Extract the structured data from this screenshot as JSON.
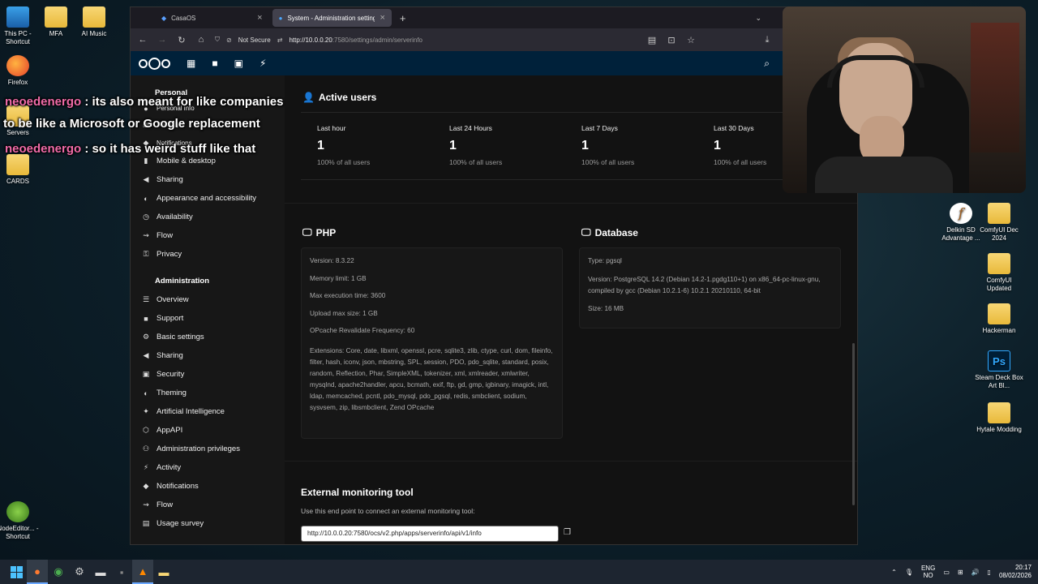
{
  "desktop": {
    "icons_left": [
      {
        "label": "This PC - Shortcut",
        "kind": "pc"
      },
      {
        "label": "MFA",
        "kind": "folder"
      },
      {
        "label": "AI Music",
        "kind": "folder"
      },
      {
        "label": "Firefox",
        "kind": "ff"
      },
      {
        "label": "Servers",
        "kind": "folder"
      },
      {
        "label": "CARDS",
        "kind": "folder"
      },
      {
        "label": "NodeEditor... - Shortcut",
        "kind": "grn"
      }
    ],
    "icons_right": [
      {
        "label": "Delkin SD Advantage ...",
        "kind": "fx"
      },
      {
        "label": "ComfyUI Dec 2024",
        "kind": "folder"
      },
      {
        "label": "ComfyUI Updated",
        "kind": "folder"
      },
      {
        "label": "Hackerman",
        "kind": "folder"
      },
      {
        "label": "Steam Deck Box Art Bl...",
        "kind": "ps"
      },
      {
        "label": "Hytale Modding",
        "kind": "folder"
      }
    ]
  },
  "browser": {
    "tabs": [
      {
        "title": "CasaOS",
        "active": false
      },
      {
        "title": "System - Administration setting",
        "active": true
      }
    ],
    "url_security": "Not Secure",
    "url_host": "http://10.0.0.20",
    "url_path": ":7580/settings/admin/serverinfo"
  },
  "chat": [
    {
      "user": "neoedenergo",
      "text": " : its also meant for like companies"
    },
    {
      "user": "",
      "text": "to be like a Microsoft or Google replacement"
    },
    {
      "user": "neoedenergo",
      "text": " : so it has weird stuff like that"
    }
  ],
  "sidebar": {
    "personal_heading": "Personal",
    "personal_items": [
      {
        "label": "Personal info",
        "icon": "person-icon"
      },
      {
        "label": "Security",
        "icon": "lock-icon"
      },
      {
        "label": "Notifications",
        "icon": "bell-icon"
      },
      {
        "label": "Mobile & desktop",
        "icon": "phone-icon"
      },
      {
        "label": "Sharing",
        "icon": "share-icon"
      },
      {
        "label": "Appearance and accessibility",
        "icon": "palette-icon"
      },
      {
        "label": "Availability",
        "icon": "clock-icon"
      },
      {
        "label": "Flow",
        "icon": "flow-icon"
      },
      {
        "label": "Privacy",
        "icon": "key-icon"
      }
    ],
    "admin_heading": "Administration",
    "admin_items": [
      {
        "label": "Overview",
        "icon": "list-icon"
      },
      {
        "label": "Support",
        "icon": "support-icon"
      },
      {
        "label": "Basic settings",
        "icon": "gear-icon"
      },
      {
        "label": "Sharing",
        "icon": "share-icon"
      },
      {
        "label": "Security",
        "icon": "lock-icon"
      },
      {
        "label": "Theming",
        "icon": "palette-icon"
      },
      {
        "label": "Artificial Intelligence",
        "icon": "ai-icon"
      },
      {
        "label": "AppAPI",
        "icon": "app-icon"
      },
      {
        "label": "Administration privileges",
        "icon": "group-icon"
      },
      {
        "label": "Activity",
        "icon": "activity-icon"
      },
      {
        "label": "Notifications",
        "icon": "bell-icon"
      },
      {
        "label": "Flow",
        "icon": "flow-icon"
      },
      {
        "label": "Usage survey",
        "icon": "survey-icon"
      }
    ]
  },
  "active_users": {
    "title": "Active users",
    "columns": [
      {
        "label": "Last hour",
        "value": "1",
        "pct": "100% of all users"
      },
      {
        "label": "Last 24 Hours",
        "value": "1",
        "pct": "100% of all users"
      },
      {
        "label": "Last 7 Days",
        "value": "1",
        "pct": "100% of all users"
      },
      {
        "label": "Last 30 Days",
        "value": "1",
        "pct": "100% of all users"
      }
    ]
  },
  "php": {
    "title": "PHP",
    "version": "Version: 8.3.22",
    "memory": "Memory limit: 1 GB",
    "max_exec": "Max execution time: 3600",
    "upload": "Upload max size: 1 GB",
    "opcache": "OPcache Revalidate Frequency: 60",
    "extensions": "Extensions: Core, date, libxml, openssl, pcre, sqlite3, zlib, ctype, curl, dom, fileinfo, filter, hash, iconv, json, mbstring, SPL, session, PDO, pdo_sqlite, standard, posix, random, Reflection, Phar, SimpleXML, tokenizer, xml, xmlreader, xmlwriter, mysqlnd, apache2handler, apcu, bcmath, exif, ftp, gd, gmp, igbinary, imagick, intl, ldap, memcached, pcntl, pdo_mysql, pdo_pgsql, redis, smbclient, sodium, sysvsem, zip, libsmbclient, Zend OPcache"
  },
  "database": {
    "title": "Database",
    "type": "Type: pgsql",
    "version": "Version: PostgreSQL 14.2 (Debian 14.2-1.pgdg110+1) on x86_64-pc-linux-gnu, compiled by gcc (Debian 10.2.1-6) 10.2.1 20210110, 64-bit",
    "size": "Size: 16 MB"
  },
  "monitoring": {
    "title": "External monitoring tool",
    "desc": "Use this end point to connect an external monitoring tool:",
    "endpoint": "http://10.0.0.20:7580/ocs/v2.php/apps/serverinfo/api/v1/info"
  },
  "taskbar": {
    "lang_top": "ENG",
    "lang_bottom": "NO",
    "time": "20:17",
    "date": "08/02/2026"
  },
  "colors": {
    "nc_header": "#00213a",
    "chat_user": "#f06ba8"
  }
}
